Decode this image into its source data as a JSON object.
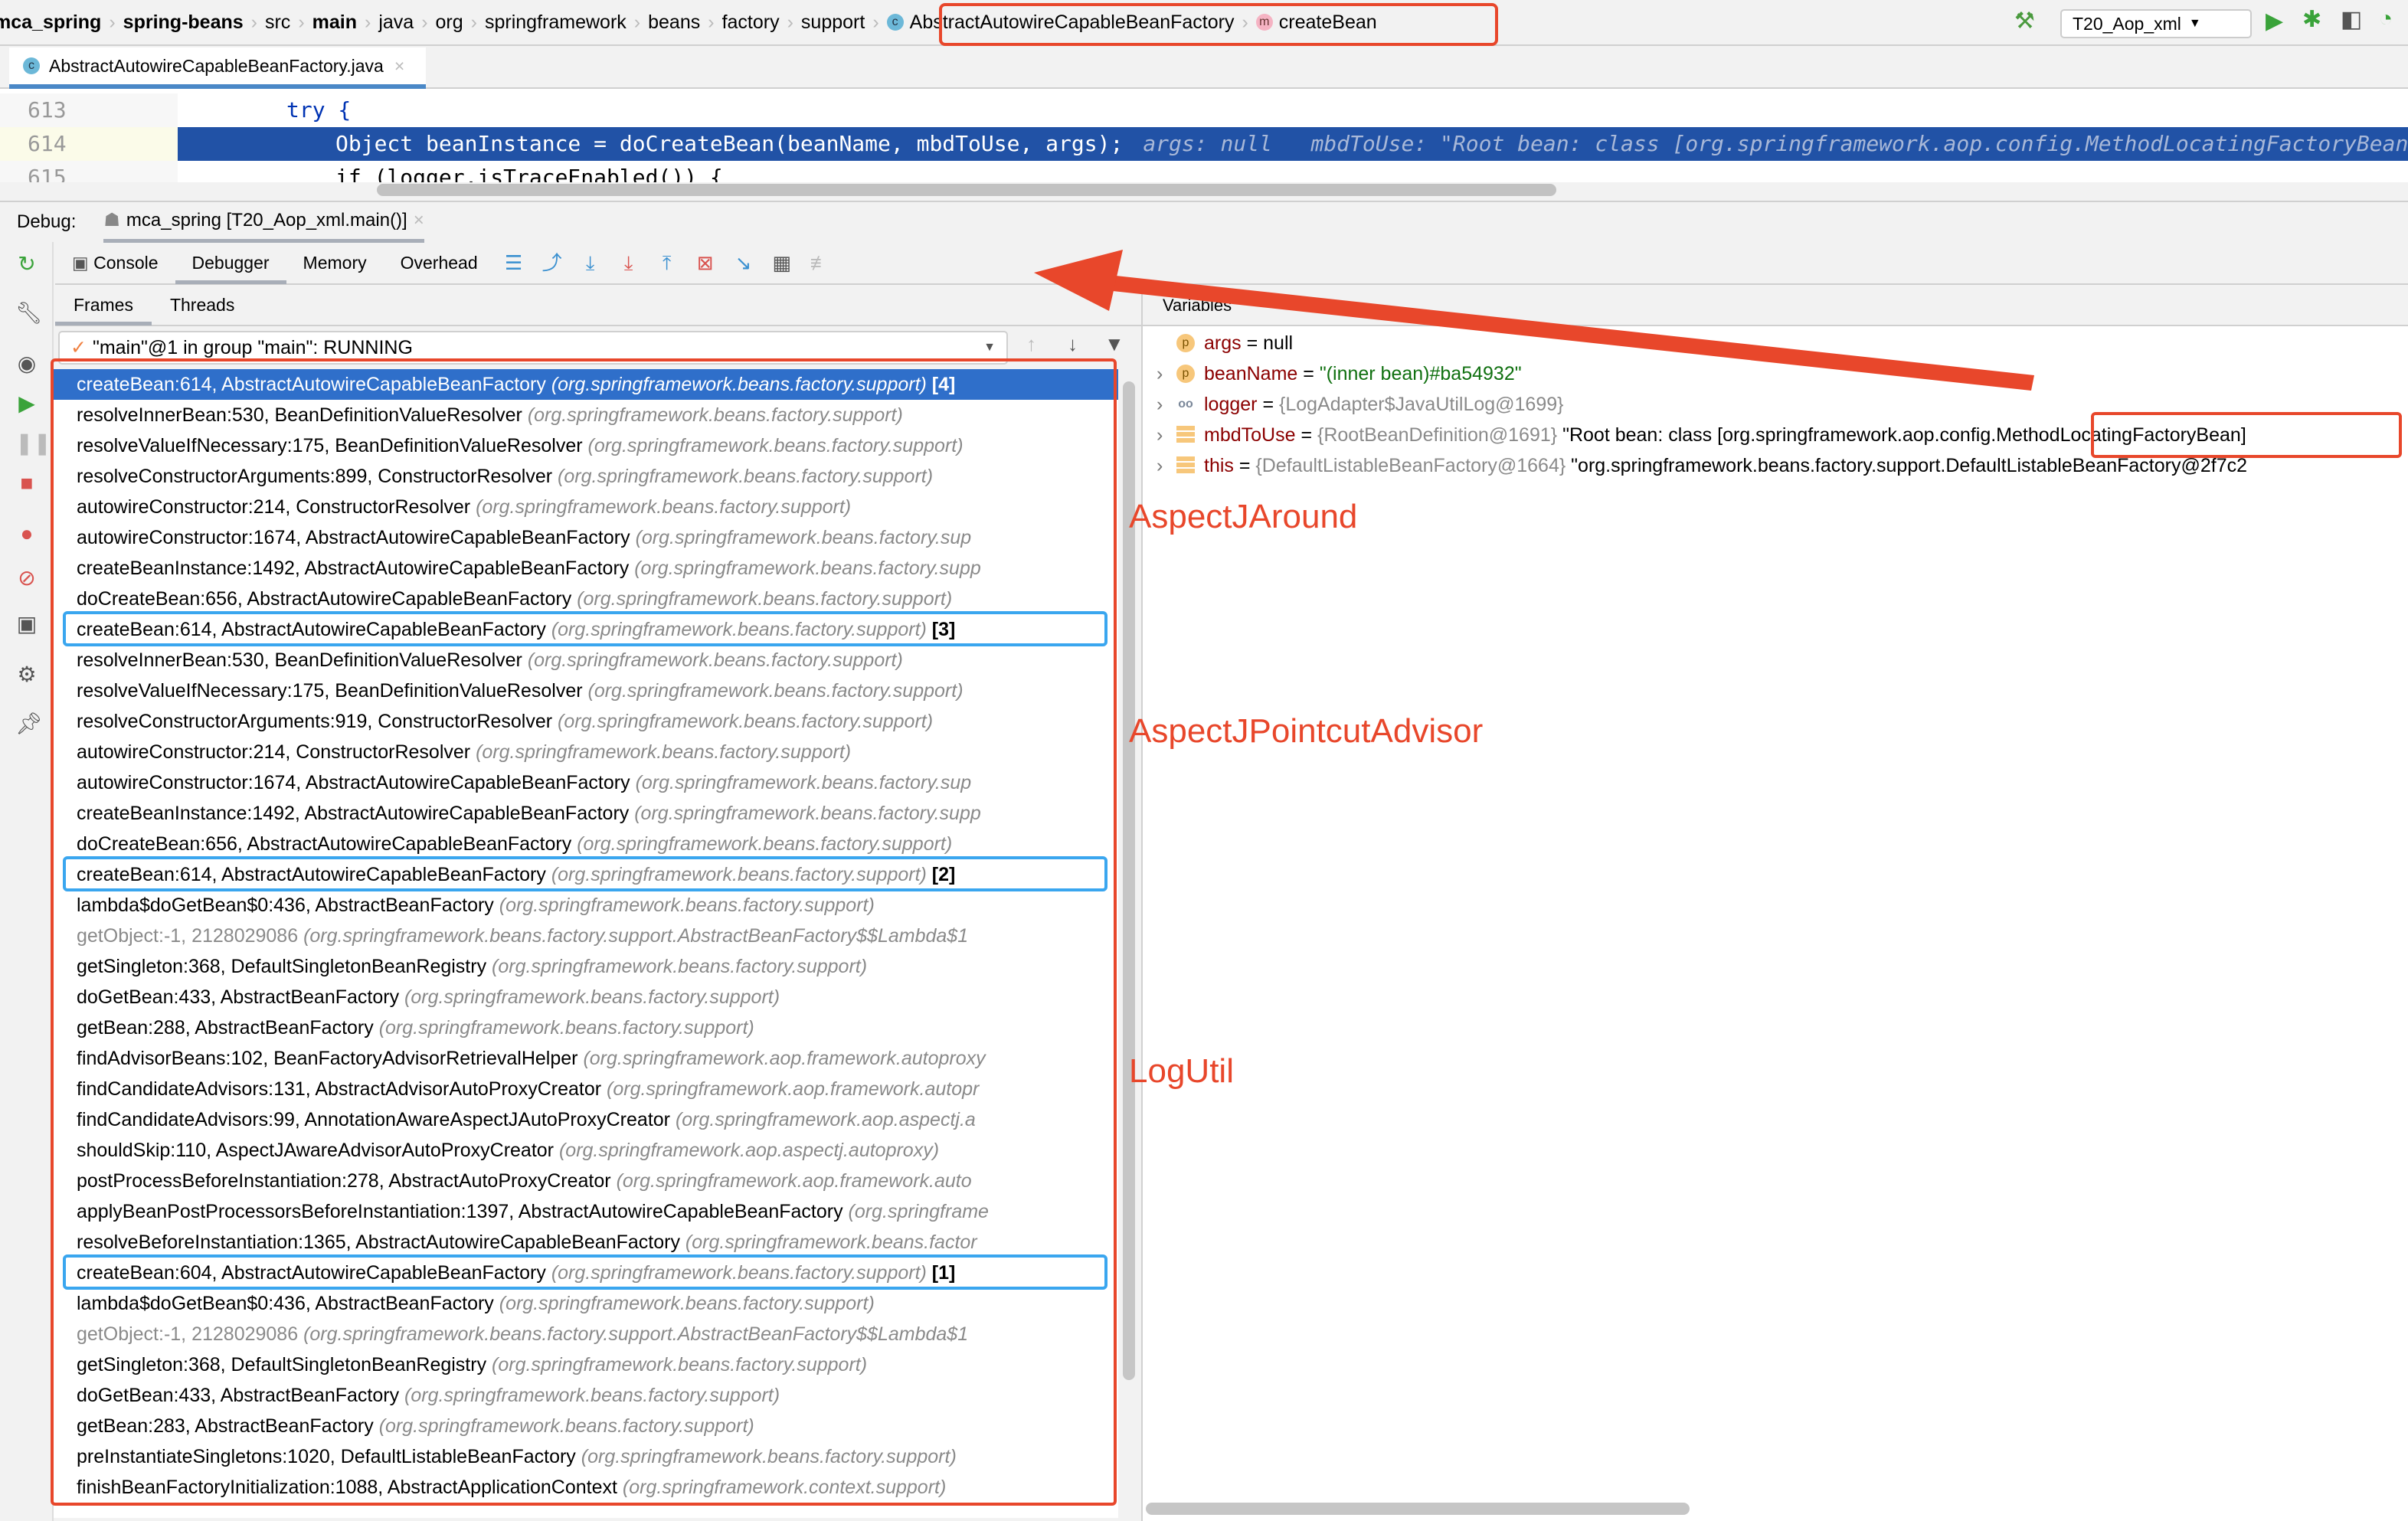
{
  "breadcrumb": [
    "mca_spring",
    "spring-beans",
    "src",
    "main",
    "java",
    "org",
    "springframework",
    "beans",
    "factory",
    "support"
  ],
  "breadcrumb_bold": [
    0,
    1,
    3
  ],
  "breadcrumb_class": "AbstractAutowireCapableBeanFactory",
  "breadcrumb_method": "createBean",
  "run_config": "T20_Aop_xml",
  "editor_tab": "AbstractAutowireCapableBeanFactory.java",
  "code": {
    "lines": [
      {
        "num": "613",
        "text": "try {"
      },
      {
        "num": "614",
        "text": "Object beanInstance = doCreateBean(beanName, mbdToUse, args);",
        "hint": "args: null   mbdToUse: \"Root bean: class [org.springframework.aop.config.MethodLocatingFactoryBean]; scop"
      },
      {
        "num": "615",
        "text": "if (logger.isTraceEnabled()) {"
      }
    ]
  },
  "debug": {
    "label": "Debug:",
    "session": "mca_spring [T20_Aop_xml.main()]"
  },
  "debug_tabs": [
    "Console",
    "Debugger",
    "Memory",
    "Overhead"
  ],
  "frame_tabs": [
    "Frames",
    "Threads"
  ],
  "thread": "\"main\"@1 in group \"main\": RUNNING",
  "frames": [
    {
      "m": "createBean:614, AbstractAutowireCapableBeanFactory",
      "p": "(org.springframework.beans.factory.support)",
      "mark": "[4]",
      "sel": true
    },
    {
      "m": "resolveInnerBean:530, BeanDefinitionValueResolver",
      "p": "(org.springframework.beans.factory.support)"
    },
    {
      "m": "resolveValueIfNecessary:175, BeanDefinitionValueResolver",
      "p": "(org.springframework.beans.factory.support)"
    },
    {
      "m": "resolveConstructorArguments:899, ConstructorResolver",
      "p": "(org.springframework.beans.factory.support)"
    },
    {
      "m": "autowireConstructor:214, ConstructorResolver",
      "p": "(org.springframework.beans.factory.support)"
    },
    {
      "m": "autowireConstructor:1674, AbstractAutowireCapableBeanFactory",
      "p": "(org.springframework.beans.factory.sup"
    },
    {
      "m": "createBeanInstance:1492, AbstractAutowireCapableBeanFactory",
      "p": "(org.springframework.beans.factory.supp"
    },
    {
      "m": "doCreateBean:656, AbstractAutowireCapableBeanFactory",
      "p": "(org.springframework.beans.factory.support)"
    },
    {
      "m": "createBean:614, AbstractAutowireCapableBeanFactory",
      "p": "(org.springframework.beans.factory.support)",
      "mark": "[3]"
    },
    {
      "m": "resolveInnerBean:530, BeanDefinitionValueResolver",
      "p": "(org.springframework.beans.factory.support)"
    },
    {
      "m": "resolveValueIfNecessary:175, BeanDefinitionValueResolver",
      "p": "(org.springframework.beans.factory.support)"
    },
    {
      "m": "resolveConstructorArguments:919, ConstructorResolver",
      "p": "(org.springframework.beans.factory.support)"
    },
    {
      "m": "autowireConstructor:214, ConstructorResolver",
      "p": "(org.springframework.beans.factory.support)"
    },
    {
      "m": "autowireConstructor:1674, AbstractAutowireCapableBeanFactory",
      "p": "(org.springframework.beans.factory.sup"
    },
    {
      "m": "createBeanInstance:1492, AbstractAutowireCapableBeanFactory",
      "p": "(org.springframework.beans.factory.supp"
    },
    {
      "m": "doCreateBean:656, AbstractAutowireCapableBeanFactory",
      "p": "(org.springframework.beans.factory.support)"
    },
    {
      "m": "createBean:614, AbstractAutowireCapableBeanFactory",
      "p": "(org.springframework.beans.factory.support)",
      "mark": "[2]"
    },
    {
      "m": "lambda$doGetBean$0:436, AbstractBeanFactory",
      "p": "(org.springframework.beans.factory.support)"
    },
    {
      "m": "getObject:-1, 2128029086",
      "p": "(org.springframework.beans.factory.support.AbstractBeanFactory$$Lambda$1",
      "gray": true
    },
    {
      "m": "getSingleton:368, DefaultSingletonBeanRegistry",
      "p": "(org.springframework.beans.factory.support)"
    },
    {
      "m": "doGetBean:433, AbstractBeanFactory",
      "p": "(org.springframework.beans.factory.support)"
    },
    {
      "m": "getBean:288, AbstractBeanFactory",
      "p": "(org.springframework.beans.factory.support)"
    },
    {
      "m": "findAdvisorBeans:102, BeanFactoryAdvisorRetrievalHelper",
      "p": "(org.springframework.aop.framework.autoproxy"
    },
    {
      "m": "findCandidateAdvisors:131, AbstractAdvisorAutoProxyCreator",
      "p": "(org.springframework.aop.framework.autopr"
    },
    {
      "m": "findCandidateAdvisors:99, AnnotationAwareAspectJAutoProxyCreator",
      "p": "(org.springframework.aop.aspectj.a"
    },
    {
      "m": "shouldSkip:110, AspectJAwareAdvisorAutoProxyCreator",
      "p": "(org.springframework.aop.aspectj.autoproxy)"
    },
    {
      "m": "postProcessBeforeInstantiation:278, AbstractAutoProxyCreator",
      "p": "(org.springframework.aop.framework.auto"
    },
    {
      "m": "applyBeanPostProcessorsBeforeInstantiation:1397, AbstractAutowireCapableBeanFactory",
      "p": "(org.springframe"
    },
    {
      "m": "resolveBeforeInstantiation:1365, AbstractAutowireCapableBeanFactory",
      "p": "(org.springframework.beans.factor"
    },
    {
      "m": "createBean:604, AbstractAutowireCapableBeanFactory",
      "p": "(org.springframework.beans.factory.support)",
      "mark": "[1]"
    },
    {
      "m": "lambda$doGetBean$0:436, AbstractBeanFactory",
      "p": "(org.springframework.beans.factory.support)"
    },
    {
      "m": "getObject:-1, 2128029086",
      "p": "(org.springframework.beans.factory.support.AbstractBeanFactory$$Lambda$1",
      "gray": true
    },
    {
      "m": "getSingleton:368, DefaultSingletonBeanRegistry",
      "p": "(org.springframework.beans.factory.support)"
    },
    {
      "m": "doGetBean:433, AbstractBeanFactory",
      "p": "(org.springframework.beans.factory.support)"
    },
    {
      "m": "getBean:283, AbstractBeanFactory",
      "p": "(org.springframework.beans.factory.support)"
    },
    {
      "m": "preInstantiateSingletons:1020, DefaultListableBeanFactory",
      "p": "(org.springframework.beans.factory.support)"
    },
    {
      "m": "finishBeanFactoryInitialization:1088, AbstractApplicationContext",
      "p": "(org.springframework.context.support)"
    }
  ],
  "variables_label": "Variables",
  "variables": [
    {
      "icon": "p",
      "name": "args",
      "type": "",
      "value": "null",
      "expand": false
    },
    {
      "icon": "p",
      "name": "beanName",
      "type": "",
      "value": "\"(inner bean)#ba54932\"",
      "str": true,
      "expand": true
    },
    {
      "icon": "oo",
      "name": "logger",
      "type": "{LogAdapter$JavaUtilLog@1699}",
      "value": "",
      "expand": true
    },
    {
      "icon": "f",
      "name": "mbdToUse",
      "type": "{RootBeanDefinition@1691}",
      "value": "\"Root bean: class [org.springframework.aop.config.MethodLocatingFactoryBean]",
      "expand": true
    },
    {
      "icon": "f",
      "name": "this",
      "type": "{DefaultListableBeanFactory@1664}",
      "value": "\"org.springframework.beans.factory.support.DefaultListableBeanFactory@2f7c2",
      "expand": true
    }
  ],
  "annotations": [
    "AspectJAround",
    "AspectJPointcutAdvisor",
    "LogUtil"
  ],
  "colors": {
    "annotation": "#e8472b",
    "highlight_box": "#3aa6ef",
    "selection": "#2f6fca",
    "code_highlight": "#2152a6"
  }
}
